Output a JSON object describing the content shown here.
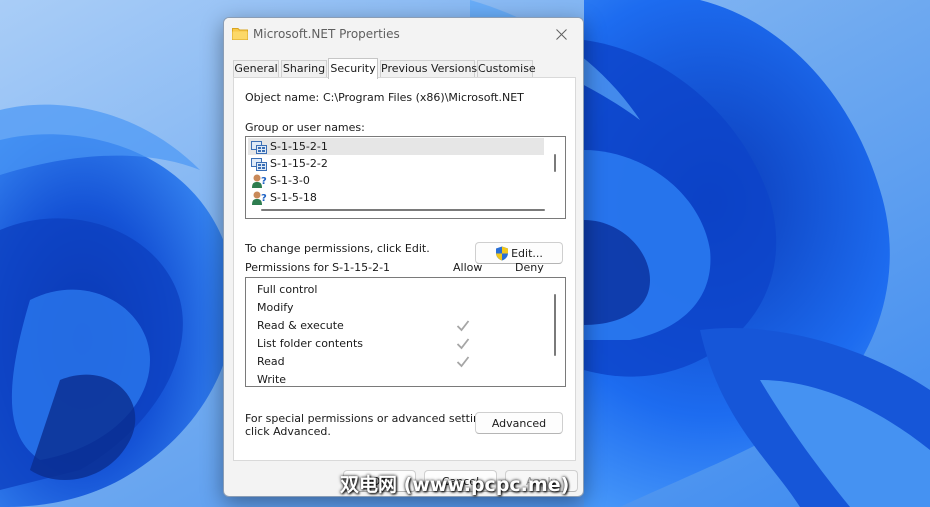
{
  "window": {
    "title": "Microsoft.NET Properties"
  },
  "tabs": [
    "General",
    "Sharing",
    "Security",
    "Previous Versions",
    "Customise"
  ],
  "active_tab": "Security",
  "object": {
    "label": "Object name:",
    "value": "C:\\Program Files (x86)\\Microsoft.NET"
  },
  "users": {
    "label": "Group or user names:",
    "items": [
      {
        "name": "S-1-15-2-1",
        "icon": "app-package-icon",
        "selected": true
      },
      {
        "name": "S-1-15-2-2",
        "icon": "app-package-icon",
        "selected": false
      },
      {
        "name": "S-1-3-0",
        "icon": "unknown-user-icon",
        "selected": false
      },
      {
        "name": "S-1-5-18",
        "icon": "unknown-user-icon",
        "selected": false
      }
    ]
  },
  "change_text": "To change permissions, click Edit.",
  "edit_button": {
    "label": "Edit...",
    "icon": "uac-shield-icon"
  },
  "permissions": {
    "title": "Permissions for S-1-15-2-1",
    "allow_header": "Allow",
    "deny_header": "Deny",
    "rows": [
      {
        "name": "Full control",
        "allow": false,
        "deny": false
      },
      {
        "name": "Modify",
        "allow": false,
        "deny": false
      },
      {
        "name": "Read & execute",
        "allow": true,
        "deny": false
      },
      {
        "name": "List folder contents",
        "allow": true,
        "deny": false
      },
      {
        "name": "Read",
        "allow": true,
        "deny": false
      },
      {
        "name": "Write",
        "allow": false,
        "deny": false
      }
    ]
  },
  "advanced": {
    "text_line1": "For special permissions or advanced settings,",
    "text_line2": "click Advanced.",
    "button_label": "Advanced"
  },
  "footer": {
    "ok_label": "OK",
    "cancel_label": "Cancel",
    "apply_label": "Apply"
  },
  "watermark": "双电网 (www.pcpc.me)",
  "colors": {
    "accent": "#0067c0",
    "check": "#a6a6a6",
    "selection": "#e6e6e6"
  }
}
